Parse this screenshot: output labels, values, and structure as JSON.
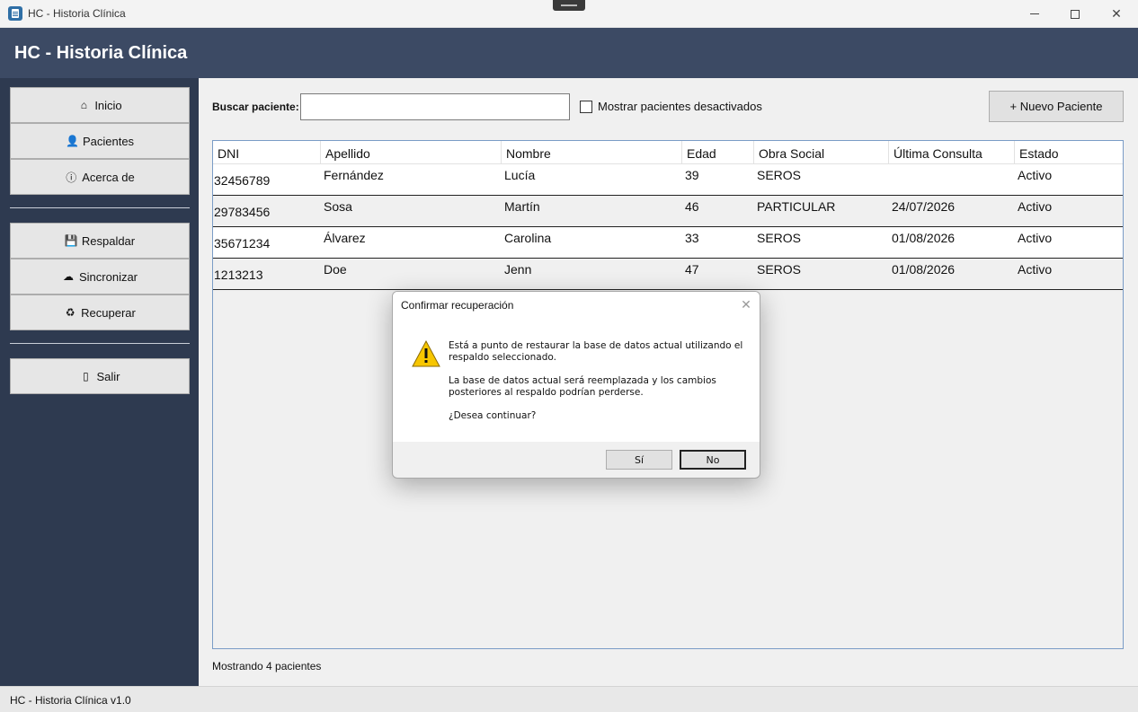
{
  "window": {
    "title": "HC - Historia Clínica",
    "minimize_icon": "minimize-icon",
    "maximize_icon": "maximize-icon",
    "close_icon": "close-icon"
  },
  "header": {
    "title": "HC - Historia Clínica"
  },
  "sidebar": {
    "items": [
      {
        "label": "Inicio",
        "icon": "home-icon",
        "glyph": "⌂"
      },
      {
        "label": "Pacientes",
        "icon": "user-icon",
        "glyph": "👤"
      },
      {
        "label": "Acerca de",
        "icon": "info-icon",
        "glyph": "ⓘ"
      },
      {
        "label": "Respaldar",
        "icon": "save-icon",
        "glyph": "💾"
      },
      {
        "label": "Sincronizar",
        "icon": "cloud-icon",
        "glyph": "☁"
      },
      {
        "label": "Recuperar",
        "icon": "recycle-icon",
        "glyph": "♻"
      },
      {
        "label": "Salir",
        "icon": "door-icon",
        "glyph": "▯"
      }
    ]
  },
  "search": {
    "label": "Buscar paciente:",
    "value": "",
    "show_inactive_label": "Mostrar pacientes desactivados",
    "show_inactive_checked": false
  },
  "new_patient_button": "+ Nuevo Paciente",
  "table": {
    "columns": [
      "DNI",
      "Apellido",
      "Nombre",
      "Edad",
      "Obra Social",
      "Última Consulta",
      "Estado"
    ],
    "rows": [
      [
        "32456789",
        "Fernández",
        "Lucía",
        "39",
        "SEROS",
        "",
        "Activo"
      ],
      [
        "29783456",
        "Sosa",
        "Martín",
        "46",
        "PARTICULAR",
        "24/07/2026",
        "Activo"
      ],
      [
        "35671234",
        "Álvarez",
        "Carolina",
        "33",
        "SEROS",
        "01/08/2026",
        "Activo"
      ],
      [
        "1213213",
        "Doe",
        "Jenn",
        "47",
        "SEROS",
        "01/08/2026",
        "Activo"
      ]
    ]
  },
  "footer_count": "Mostrando 4 pacientes",
  "statusbar": "HC - Historia Clínica v1.0",
  "dialog": {
    "title": "Confirmar recuperación",
    "icon": "warning-icon",
    "line1": "Está a punto de restaurar la base de datos actual utilizando el",
    "line2": "respaldo seleccionado.",
    "line3": "La base de datos actual será reemplazada y los cambios",
    "line4": "posteriores al respaldo podrían perderse.",
    "line5": "¿Desea continuar?",
    "yes": "Sí",
    "no": "No"
  },
  "colors": {
    "header": "#3c4a64",
    "sidebar": "#2e3a50",
    "content": "#f0f0f0"
  }
}
